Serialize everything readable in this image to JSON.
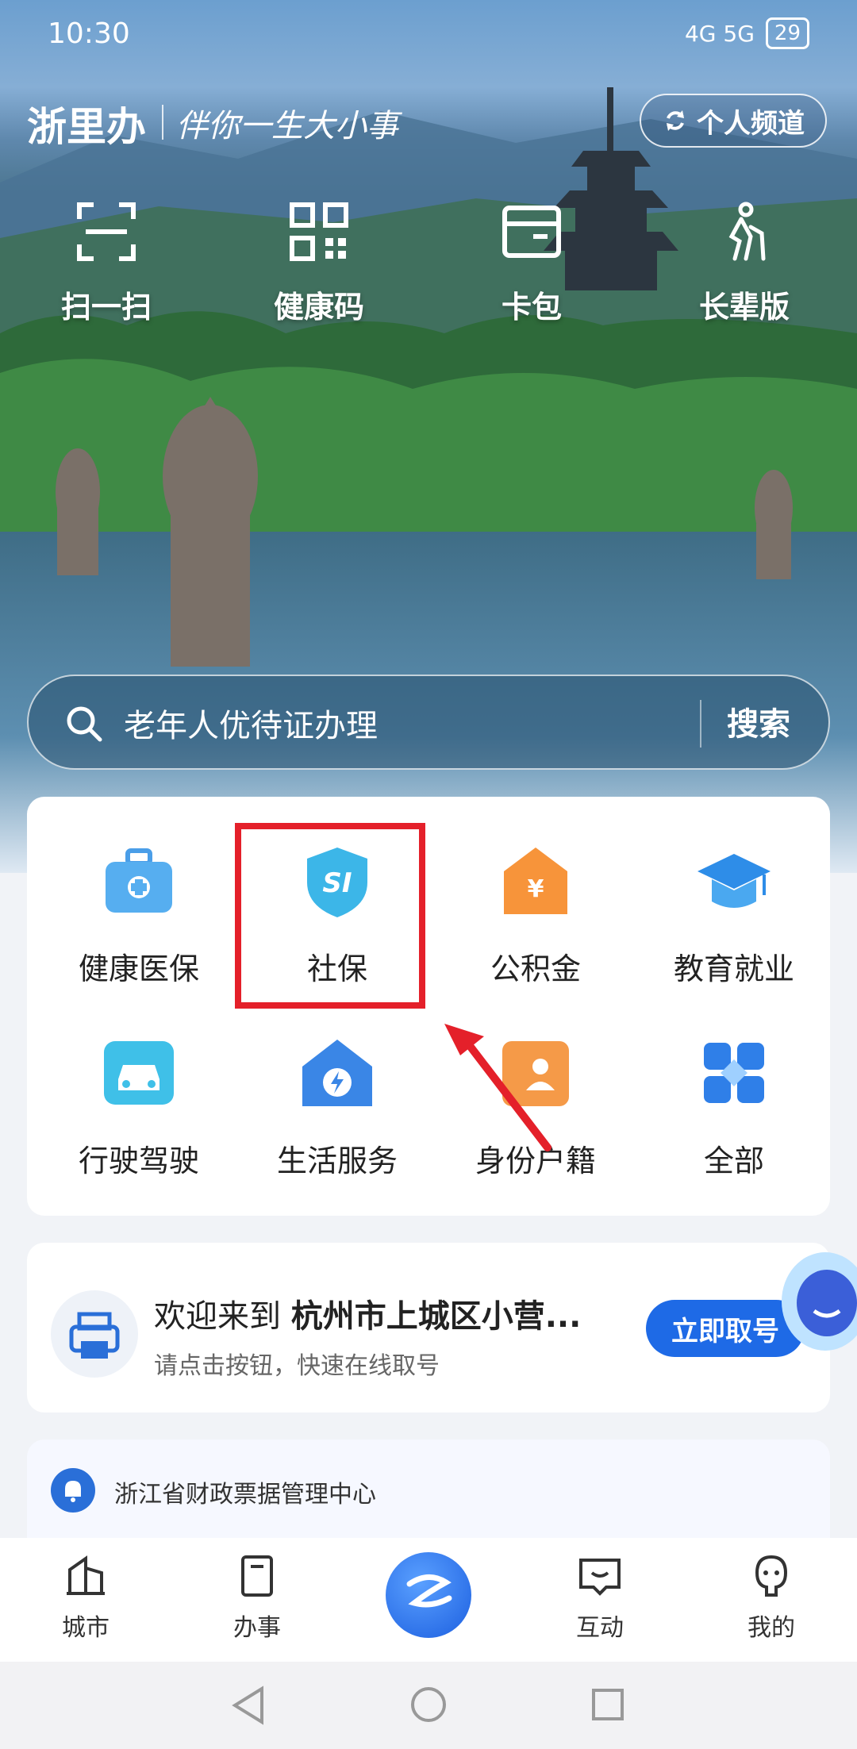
{
  "status": {
    "time": "10:30",
    "icons": "N ✱",
    "signal": "4G 5G",
    "battery": "29"
  },
  "header": {
    "brand": "浙里办",
    "slogan": "伴你一生大小事",
    "channel_button": "个人频道"
  },
  "quick_actions": [
    {
      "label": "扫一扫",
      "icon": "scan-icon"
    },
    {
      "label": "健康码",
      "icon": "qr-code-icon"
    },
    {
      "label": "卡包",
      "icon": "card-wallet-icon"
    },
    {
      "label": "长辈版",
      "icon": "elder-mode-icon"
    }
  ],
  "search": {
    "placeholder": "老年人优待证办理",
    "button": "搜索"
  },
  "services": [
    {
      "label": "健康医保",
      "icon": "medical-kit-icon"
    },
    {
      "label": "社保",
      "icon": "social-security-shield-icon"
    },
    {
      "label": "公积金",
      "icon": "housing-fund-icon"
    },
    {
      "label": "教育就业",
      "icon": "graduation-cap-icon"
    },
    {
      "label": "行驶驾驶",
      "icon": "car-icon"
    },
    {
      "label": "生活服务",
      "icon": "home-service-icon"
    },
    {
      "label": "身份户籍",
      "icon": "id-card-icon"
    },
    {
      "label": "全部",
      "icon": "all-grid-icon"
    }
  ],
  "queue": {
    "welcome": "欢迎来到",
    "place": "杭州市上城区小营...",
    "subtitle": "请点击按钮，快速在线取号",
    "button": "立即取号"
  },
  "notice": {
    "title": "浙江省财政票据管理中心"
  },
  "bottom_nav": [
    {
      "label": "城市",
      "icon": "city-icon"
    },
    {
      "label": "办事",
      "icon": "affairs-icon"
    },
    {
      "label": "",
      "icon": "home-logo-icon"
    },
    {
      "label": "互动",
      "icon": "chat-icon"
    },
    {
      "label": "我的",
      "icon": "profile-icon"
    }
  ],
  "colors": {
    "accent": "#1e6ae6",
    "highlight": "#e4202a"
  }
}
